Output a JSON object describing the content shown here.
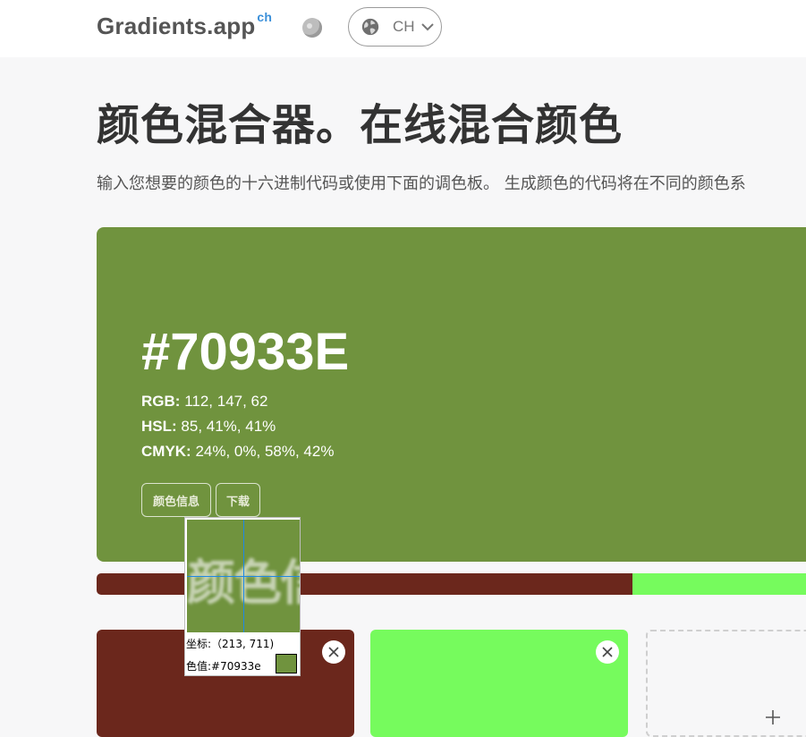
{
  "header": {
    "logo": "Gradients.app",
    "logo_sup": "ch",
    "language": "CH"
  },
  "page": {
    "title": "颜色混合器。在线混合颜色",
    "subtitle": "输入您想要的颜色的十六进制代码或使用下面的调色板。 生成颜色的代码将在不同的颜色系"
  },
  "result": {
    "hex": "#70933E",
    "color": "#70933e",
    "rgb_label": "RGB:",
    "rgb_value": "112, 147, 62",
    "hsl_label": "HSL:",
    "hsl_value": "85, 41%, 41%",
    "cmyk_label": "CMYK:",
    "cmyk_value": "24%, 0%, 58%, 42%",
    "btn_info": "颜色信息",
    "btn_download": "下载"
  },
  "mix": {
    "color_a": "#6b271c",
    "color_b": "#76fb5d",
    "split_fraction": 0.74
  },
  "swatches": [
    {
      "color": "#6b271c"
    },
    {
      "color": "#76fb5d"
    }
  ],
  "magnifier": {
    "preview_text": "颜色信",
    "coord_line": "坐标:（213, 711)",
    "color_line": "色值:#70933e",
    "color": "#70933e"
  },
  "icons": {
    "globe": "globe-icon",
    "chevron": "chevron-down-icon",
    "close": "close-icon",
    "plus": "plus-icon",
    "theme": "theme-toggle-icon"
  }
}
